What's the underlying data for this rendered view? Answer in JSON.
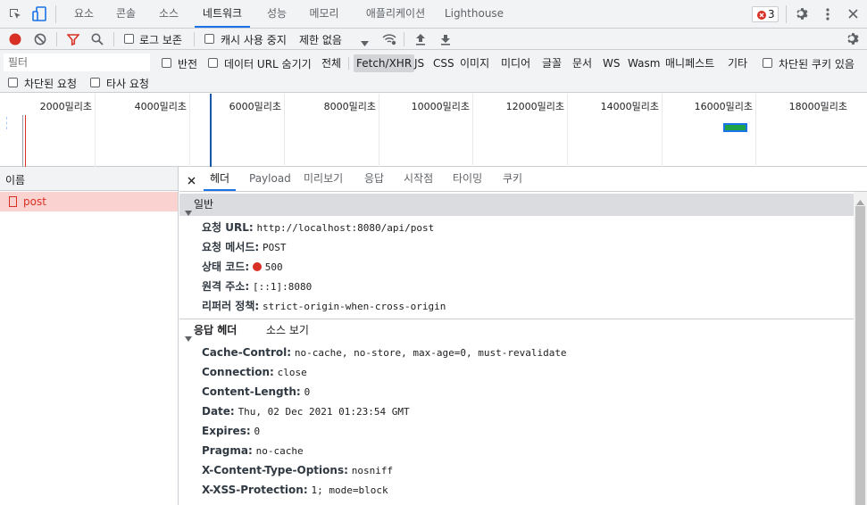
{
  "tabs": [
    {
      "label": "요소"
    },
    {
      "label": "콘솔"
    },
    {
      "label": "소스"
    },
    {
      "label": "네트워크"
    },
    {
      "label": "성능"
    },
    {
      "label": "메모리"
    },
    {
      "label": "애플리케이션"
    },
    {
      "label": "Lighthouse"
    }
  ],
  "error_count": "3",
  "toolbar": {
    "preserve_log": "로그 보존",
    "disable_cache": "캐시 사용 중지",
    "throttle": "제한 없음"
  },
  "filter": {
    "placeholder": "필터",
    "invert": "반전",
    "hide_data_urls": "데이터 URL 숨기기",
    "types": [
      "전체",
      "Fetch/XHR",
      "JS",
      "CSS",
      "이미지",
      "미디어",
      "글꼴",
      "문서",
      "WS",
      "Wasm",
      "매니페스트",
      "기타"
    ],
    "selected_type": "Fetch/XHR",
    "blocked_cookies": "차단된 쿠키 있음",
    "blocked_requests": "차단된 요청",
    "third_party": "타사 요청"
  },
  "timeline": {
    "ticks": [
      "2000밀리초",
      "4000밀리초",
      "6000밀리초",
      "8000밀리초",
      "10000밀리초",
      "12000밀리초",
      "14000밀리초",
      "16000밀리초",
      "18000밀리초"
    ]
  },
  "names_panel": {
    "header": "이름",
    "requests": [
      {
        "name": "post",
        "status": "error"
      }
    ]
  },
  "detail_tabs": [
    "헤더",
    "Payload",
    "미리보기",
    "응답",
    "시작점",
    "타이밍",
    "쿠키"
  ],
  "general": {
    "title": "일반",
    "rows": [
      {
        "key": "요청 URL:",
        "value": "http://localhost:8080/api/post"
      },
      {
        "key": "요청 메서드:",
        "value": "POST"
      },
      {
        "key": "상태 코드:",
        "value": "500"
      },
      {
        "key": "원격 주소:",
        "value": "[::1]:8080"
      },
      {
        "key": "리퍼러 정책:",
        "value": "strict-origin-when-cross-origin"
      }
    ]
  },
  "response_headers": {
    "title": "응답 헤더",
    "view_source": "소스 보기",
    "rows": [
      {
        "key": "Cache-Control:",
        "value": "no-cache, no-store, max-age=0, must-revalidate"
      },
      {
        "key": "Connection:",
        "value": "close"
      },
      {
        "key": "Content-Length:",
        "value": "0"
      },
      {
        "key": "Date:",
        "value": "Thu, 02 Dec 2021 01:23:54 GMT"
      },
      {
        "key": "Expires:",
        "value": "0"
      },
      {
        "key": "Pragma:",
        "value": "no-cache"
      },
      {
        "key": "X-Content-Type-Options:",
        "value": "nosniff"
      },
      {
        "key": "X-XSS-Protection:",
        "value": "1; mode=block"
      }
    ]
  },
  "colors": {
    "accent": "#1a73e8",
    "error": "#d93025",
    "record": "#d93025",
    "selected_row": "#fad2cf"
  }
}
